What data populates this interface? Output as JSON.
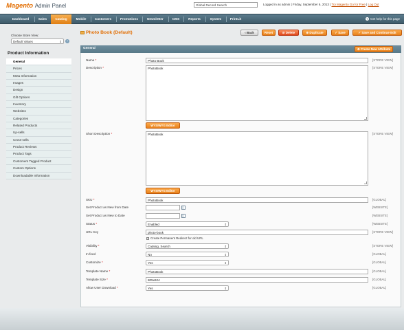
{
  "header": {
    "brand": "Magento",
    "panel": "Admin Panel",
    "search_value": "Global Record Search",
    "logged_in": "Logged in as admin | Friday, September 6, 2013 |",
    "try_link": "Try Magento Go for Free",
    "logout": "Log Out"
  },
  "nav": {
    "items": [
      "Dashboard",
      "Sales",
      "Catalog",
      "Mobile",
      "Customers",
      "Promotions",
      "Newsletter",
      "CMS",
      "Reports",
      "System",
      "PrintLit"
    ],
    "help": "Get help for this page"
  },
  "sidebar": {
    "store_view_label": "Choose Store View:",
    "store_view_value": "Default Values",
    "section_title": "Product Information",
    "tabs": [
      "General",
      "Prices",
      "Meta Information",
      "Images",
      "Design",
      "Gift Options",
      "Inventory",
      "Websites",
      "Categories",
      "Related Products",
      "Up-sells",
      "Cross-sells",
      "Product Reviews",
      "Product Tags",
      "Customers Tagged Product",
      "Custom Options",
      "Downloadable Information"
    ]
  },
  "page": {
    "title": "Photo Book (Default)",
    "buttons": {
      "back": "Back",
      "reset": "Reset",
      "delete": "Delete",
      "duplicate": "Duplicate",
      "save": "Save",
      "save_continue": "Save and Continue Edit"
    }
  },
  "form": {
    "section": "General",
    "create_attr": "Create New Attribute",
    "wysiwyg": "WYSIWYG Editor",
    "fields": {
      "name": {
        "label": "Name",
        "value": "Photo Book",
        "scope": "[STORE VIEW]"
      },
      "description": {
        "label": "Description",
        "value": "PhotoBook",
        "scope": "[STORE VIEW]"
      },
      "short_description": {
        "label": "Short Description",
        "value": "PhotoBook",
        "scope": "[STORE VIEW]"
      },
      "sku": {
        "label": "SKU",
        "value": "PhotoBook",
        "scope": "[GLOBAL]"
      },
      "new_from": {
        "label": "Set Product as New from Date",
        "value": "",
        "scope": "[WEBSITE]"
      },
      "new_to": {
        "label": "Set Product as New to Date",
        "value": "",
        "scope": "[WEBSITE]"
      },
      "status": {
        "label": "Status",
        "value": "Enabled",
        "scope": "[WEBSITE]"
      },
      "url_key": {
        "label": "URL Key",
        "value": "photo-book",
        "scope": "[STORE VIEW]",
        "redirect": "Create Permanent Redirect for old URL"
      },
      "visibility": {
        "label": "Visibility",
        "value": "Catalog, Search",
        "scope": "[STORE VIEW]"
      },
      "in_feed": {
        "label": "In feed",
        "value": "No",
        "scope": "[GLOBAL]"
      },
      "customize": {
        "label": "Customize",
        "value": "Yes",
        "scope": "[GLOBAL]"
      },
      "template_name": {
        "label": "Template Name",
        "value": "PhotoBook",
        "scope": "[GLOBAL]"
      },
      "template_size": {
        "label": "Template Size",
        "value": "805x624",
        "scope": "[GLOBAL]"
      },
      "allow_download": {
        "label": "Allow User Download",
        "value": "Yes",
        "scope": "[GLOBAL]"
      }
    }
  }
}
